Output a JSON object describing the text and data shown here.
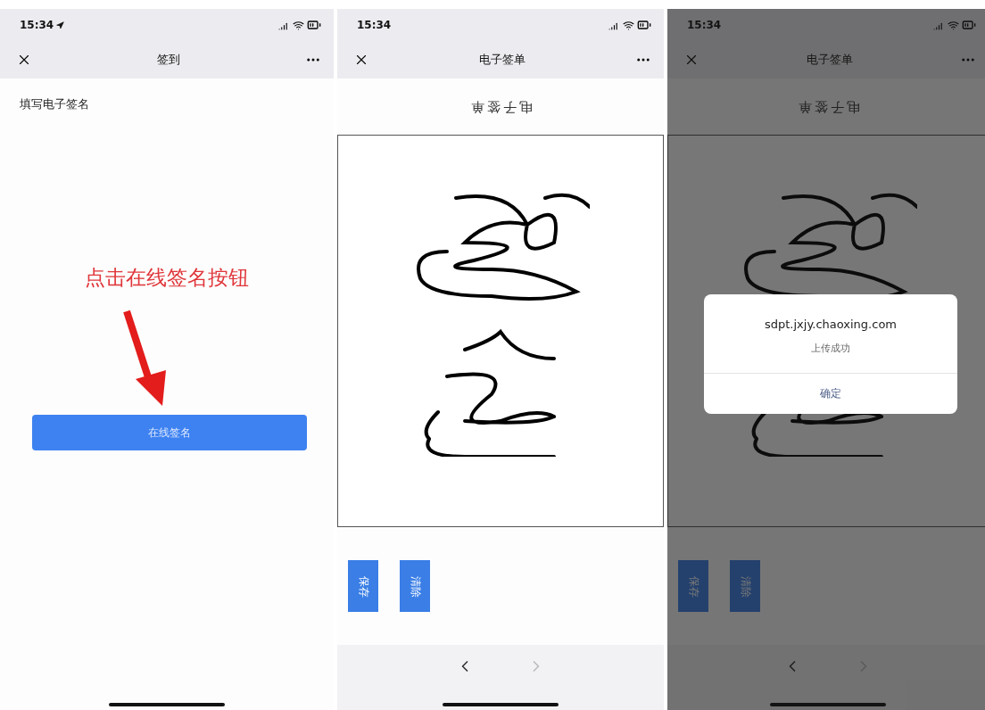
{
  "screens": [
    {
      "kind": "sign_in",
      "status_bar": {
        "time": "15:34",
        "location_on": true
      },
      "nav": {
        "title": "签到"
      },
      "label": "填写电子签名",
      "annotation": "点击在线签名按钮",
      "button": "在线签名"
    },
    {
      "kind": "signature_pad",
      "status_bar": {
        "time": "15:34",
        "location_on": false
      },
      "nav": {
        "title": "电子签单"
      },
      "heading": "电子签单",
      "buttons": [
        "保存",
        "清除"
      ],
      "browser_nav": {
        "back_disabled": false,
        "forward_disabled": true
      },
      "dimmed": false
    },
    {
      "kind": "signature_pad",
      "status_bar": {
        "time": "15:34",
        "location_on": false
      },
      "nav": {
        "title": "电子签单"
      },
      "heading": "电子签单",
      "buttons": [
        "保存",
        "清除"
      ],
      "browser_nav": {
        "back_disabled": false,
        "forward_disabled": true
      },
      "dimmed": true,
      "dialog": {
        "title": "sdpt.jxjy.chaoxing.com",
        "message": "上传成功",
        "button": "确定"
      }
    }
  ]
}
